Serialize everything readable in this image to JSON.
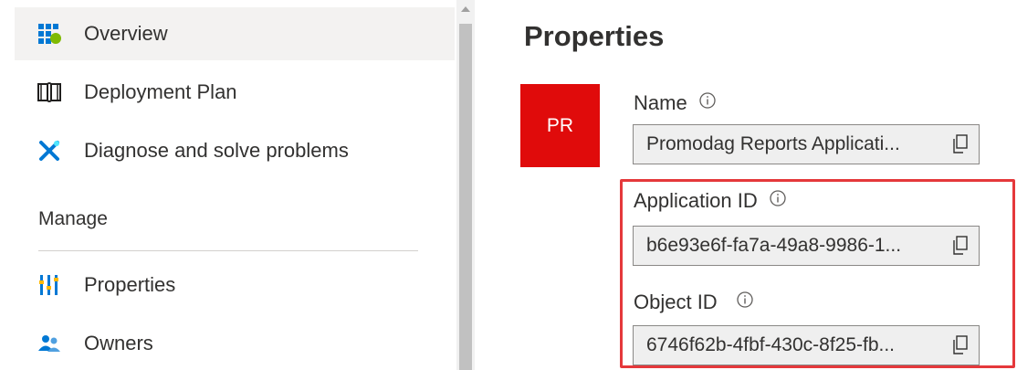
{
  "sidebar": {
    "items": [
      {
        "label": "Overview",
        "icon": "overview-grid-icon"
      },
      {
        "label": "Deployment Plan",
        "icon": "book-icon"
      },
      {
        "label": "Diagnose and solve problems",
        "icon": "tools-icon"
      },
      {
        "label": "Properties",
        "icon": "properties-bars-icon"
      },
      {
        "label": "Owners",
        "icon": "users-icon"
      }
    ],
    "section_header": "Manage",
    "active_item": "Overview"
  },
  "main": {
    "title": "Properties",
    "avatar_initials": "PR",
    "avatar_color": "#e00b0b",
    "fields": {
      "name": {
        "label": "Name",
        "value": "Promodag Reports Applicati..."
      },
      "application_id": {
        "label": "Application ID",
        "value": "b6e93e6f-fa7a-49a8-9986-1..."
      },
      "object_id": {
        "label": "Object ID",
        "value": "6746f62b-4fbf-430c-8f25-fb..."
      }
    },
    "highlight_color": "#e5383b"
  }
}
